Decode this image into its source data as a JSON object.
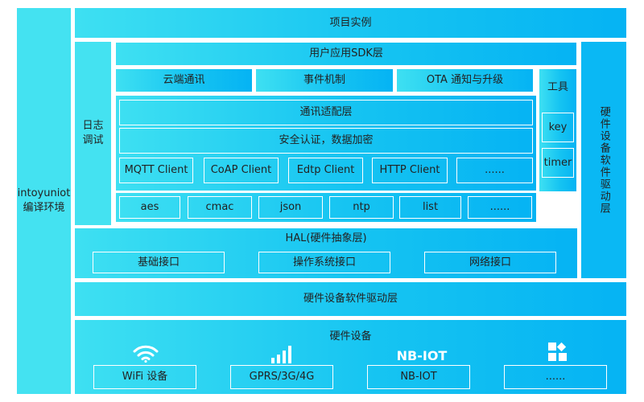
{
  "env": {
    "name": "intoyuniot",
    "label": "编译环境"
  },
  "project": {
    "label": "项目实例"
  },
  "log": {
    "label1": "日志",
    "label2": "调试"
  },
  "sdk": {
    "label": "用户应用SDK层"
  },
  "features": [
    "云端通讯",
    "事件机制",
    "OTA 通知与升级"
  ],
  "tools": {
    "label": "工具",
    "items": [
      "key",
      "timer"
    ]
  },
  "comm": {
    "adapter": "通讯适配层",
    "security": "安全认证，数据加密",
    "clients": [
      "MQTT Client",
      "CoAP Client",
      "Edtp Client",
      "HTTP Client",
      "......"
    ]
  },
  "libs": [
    "aes",
    "cmac",
    "json",
    "ntp",
    "list",
    "......"
  ],
  "driver_right": {
    "label": "硬件设备软件驱动层"
  },
  "hal": {
    "title": "HAL(硬件抽象层)",
    "interfaces": [
      "基础接口",
      "操作系统接口",
      "网络接口"
    ]
  },
  "driver_bottom": {
    "label": "硬件设备软件驱动层"
  },
  "hardware": {
    "title": "硬件设备",
    "icons": [
      "wifi-icon",
      "signal-bars-icon",
      "nb-iot-logo",
      "apps-grid-icon"
    ],
    "nbiot_logo_text": "NB-IOT",
    "items": [
      "WiFi 设备",
      "GPRS/3G/4G",
      "NB-IOT",
      "......"
    ]
  },
  "colors": {
    "left_column": "#44e2f1",
    "right_column": "#0ab8f4",
    "gradient_start": "#3ee0f2",
    "gradient_end": "#05b3f3",
    "inner": "#ffffff"
  }
}
